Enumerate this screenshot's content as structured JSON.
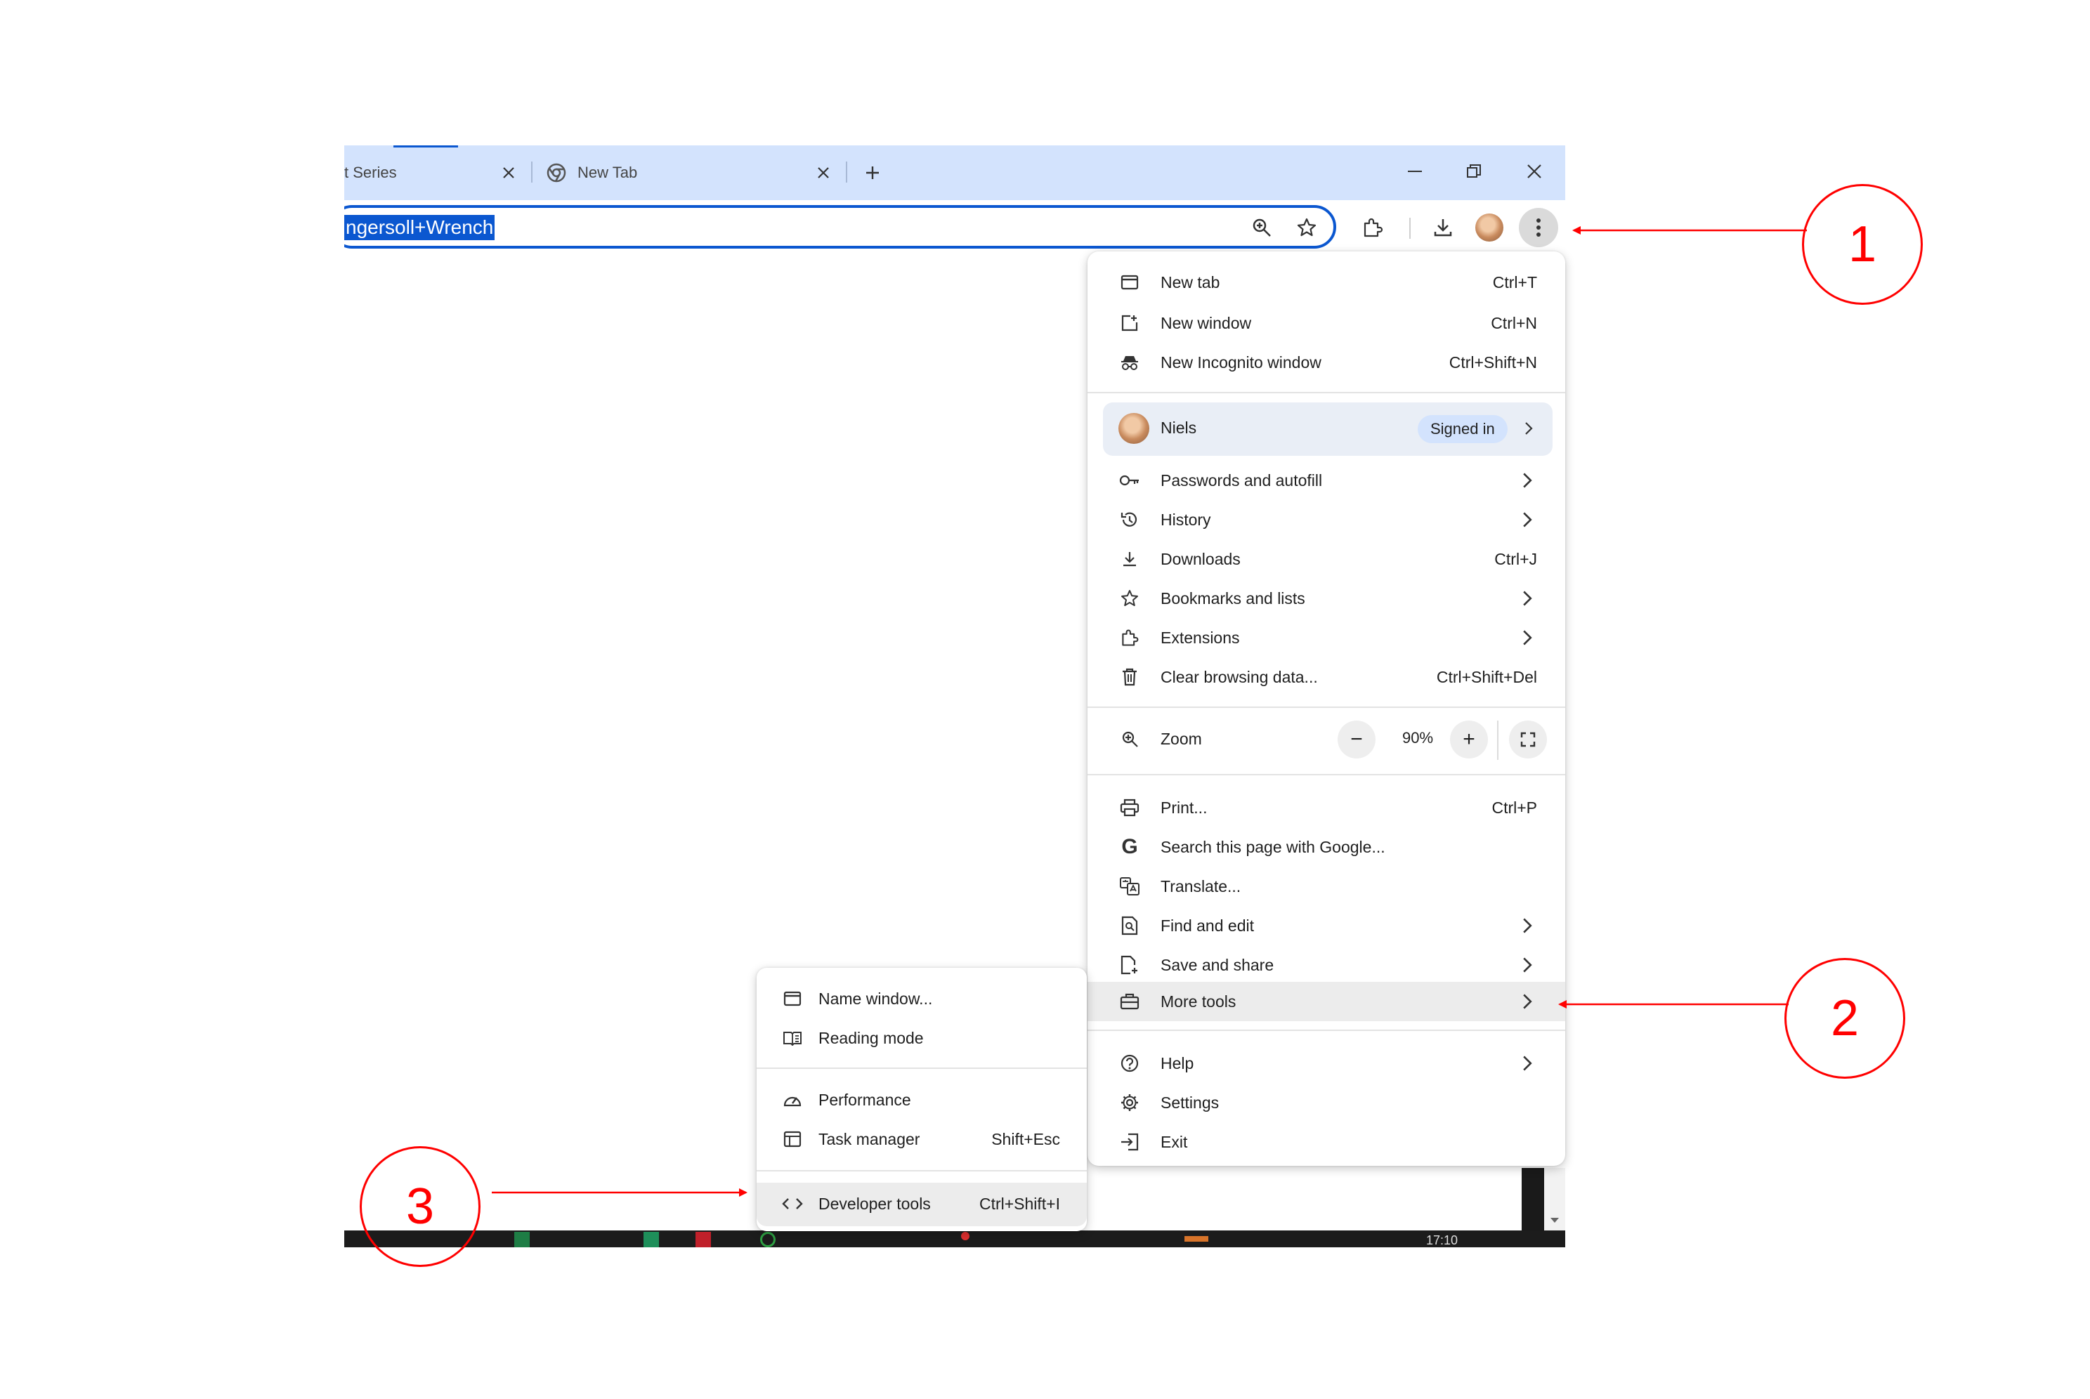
{
  "browser": {
    "tabs": [
      {
        "title": "t Series",
        "close": "×"
      },
      {
        "title": "New Tab",
        "close": "×"
      }
    ],
    "new_tab_label": "+",
    "window_controls": {
      "minimize": "minimize-icon",
      "restore": "restore-icon",
      "close": "close-icon"
    },
    "omnibox_text": "ngersoll+Wrench",
    "accent_color": "#0b57d0",
    "tabstrip_color": "#d3e3fd"
  },
  "menu": {
    "items_top": [
      {
        "label": "New tab",
        "shortcut": "Ctrl+T",
        "icon": "new-tab-icon"
      },
      {
        "label": "New window",
        "shortcut": "Ctrl+N",
        "icon": "new-window-icon"
      },
      {
        "label": "New Incognito window",
        "shortcut": "Ctrl+Shift+N",
        "icon": "incognito-icon"
      }
    ],
    "profile": {
      "name": "Niels",
      "status": "Signed in"
    },
    "items_mid": [
      {
        "label": "Passwords and autofill",
        "icon": "key-icon"
      },
      {
        "label": "History",
        "icon": "history-icon"
      },
      {
        "label": "Downloads",
        "shortcut": "Ctrl+J",
        "icon": "download-icon"
      },
      {
        "label": "Bookmarks and lists",
        "icon": "star-icon"
      },
      {
        "label": "Extensions",
        "icon": "extension-icon"
      },
      {
        "label": "Clear browsing data...",
        "shortcut": "Ctrl+Shift+Del",
        "icon": "trash-icon"
      }
    ],
    "zoom": {
      "label": "Zoom",
      "value": "90%",
      "minus": "−",
      "plus": "+"
    },
    "items_tools": [
      {
        "label": "Print...",
        "shortcut": "Ctrl+P",
        "icon": "print-icon"
      },
      {
        "label": "Search this page with Google...",
        "icon": "google-icon"
      },
      {
        "label": "Translate...",
        "icon": "translate-icon"
      },
      {
        "label": "Find and edit",
        "icon": "find-icon"
      },
      {
        "label": "Save and share",
        "icon": "save-share-icon"
      },
      {
        "label": "More tools",
        "icon": "toolbox-icon"
      }
    ],
    "items_bottom": [
      {
        "label": "Help",
        "icon": "help-icon"
      },
      {
        "label": "Settings",
        "icon": "settings-icon"
      },
      {
        "label": "Exit",
        "icon": "exit-icon"
      }
    ]
  },
  "submenu": {
    "items": [
      {
        "label": "Name window...",
        "icon": "window-icon"
      },
      {
        "label": "Reading mode",
        "icon": "reading-mode-icon"
      },
      {
        "label": "Performance",
        "icon": "performance-icon"
      },
      {
        "label": "Task manager",
        "shortcut": "Shift+Esc",
        "icon": "task-manager-icon"
      },
      {
        "label": "Developer tools",
        "shortcut": "Ctrl+Shift+I",
        "icon": "code-icon"
      }
    ]
  },
  "taskbar": {
    "time": "17:10"
  },
  "annotations": {
    "color": "#ff0000",
    "callouts": [
      "1",
      "2",
      "3"
    ]
  }
}
